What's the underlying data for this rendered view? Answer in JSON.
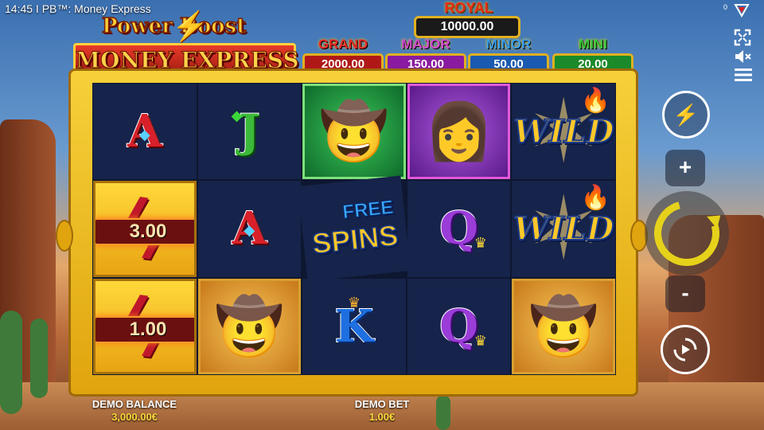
{
  "status_bar": {
    "text": "14:45 I PB™: Money Express",
    "counter": "0"
  },
  "logo": {
    "line1": "Power Boost",
    "line2": "MONEY EXPRESS"
  },
  "jackpots": {
    "royal": {
      "label": "ROYAL",
      "value": "10000.00"
    },
    "grand": {
      "label": "GRAND",
      "value": "2000.00",
      "color": "#e8282a"
    },
    "major": {
      "label": "MAJOR",
      "value": "150.00",
      "color": "#c83ac8"
    },
    "minor": {
      "label": "MINOR",
      "value": "50.00",
      "color": "#2a8ae0"
    },
    "mini": {
      "label": "MINI",
      "value": "20.00",
      "color": "#3ab83a"
    }
  },
  "reels": [
    [
      "A",
      "3.00",
      "1.00"
    ],
    [
      "J",
      "A",
      "sheriff"
    ],
    [
      "outlaw",
      "FREE SPINS",
      "K"
    ],
    [
      "cowgirl",
      "Q",
      "Q"
    ],
    [
      "WILD",
      "WILD",
      "sheriff"
    ]
  ],
  "symbols": {
    "multiplier_1": "3.00",
    "multiplier_2": "1.00",
    "wild": "WILD",
    "free": "FREE",
    "spins": "SPINS",
    "letter_a": "A",
    "letter_j": "J",
    "letter_q": "Q",
    "letter_k": "K"
  },
  "controls": {
    "plus": "+",
    "minus": "-",
    "icons": [
      "fullscreen-icon",
      "mute-icon",
      "menu-icon",
      "turbo-icon",
      "spin-icon",
      "autoplay-icon"
    ]
  },
  "footer": {
    "balance_label": "DEMO BALANCE",
    "balance_value": "3,000.00€",
    "bet_label": "DEMO BET",
    "bet_value": "1.00€"
  }
}
